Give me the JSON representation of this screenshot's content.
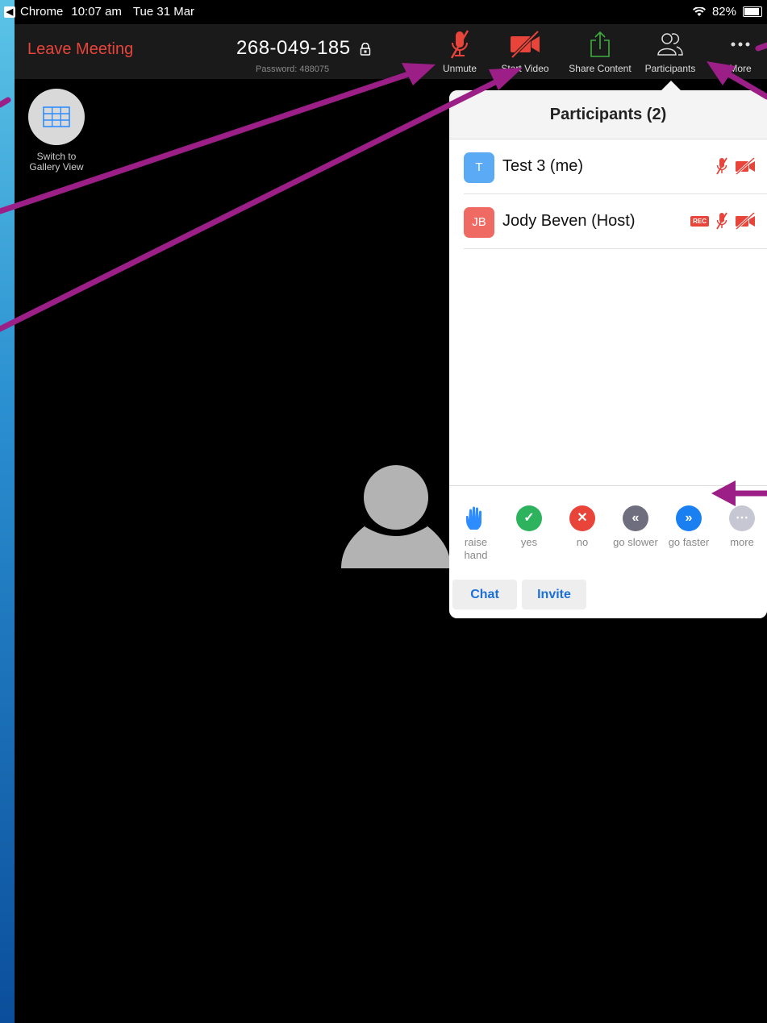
{
  "status_bar": {
    "back_app": "Chrome",
    "time": "10:07 am",
    "date": "Tue 31 Mar",
    "battery": "82%",
    "battery_level": 0.82
  },
  "toolbar": {
    "leave_label": "Leave Meeting",
    "meeting_id": "268-049-185",
    "password": "Password: 488075",
    "buttons": [
      {
        "label": "Unmute",
        "icon": "muted-mic-icon",
        "color": "#e8443a"
      },
      {
        "label": "Start Video",
        "icon": "video-off-icon",
        "color": "#e8443a"
      },
      {
        "label": "Share Content",
        "icon": "share-icon",
        "color": "#3fae3f"
      },
      {
        "label": "Participants",
        "icon": "participants-icon",
        "color": "#dddddd"
      },
      {
        "label": "More",
        "icon": "more-icon",
        "color": "#dddddd"
      }
    ]
  },
  "gallery": {
    "label_line1": "Switch to",
    "label_line2": "Gallery View"
  },
  "participants_panel": {
    "title": "Participants (2)",
    "participants": [
      {
        "initials": "T",
        "name": "Test 3 (me)",
        "avatar_color": "#5aaaf5",
        "recording": false
      },
      {
        "initials": "JB",
        "name": "Jody Beven (Host)",
        "avatar_color": "#f06a64",
        "recording": true,
        "rec_badge": "REC"
      }
    ],
    "reactions": [
      {
        "line1": "raise",
        "line2": "hand",
        "icon": "raise-hand-icon",
        "color": "#2d8cff"
      },
      {
        "line1": "yes",
        "line2": "",
        "icon": "checkmark-icon",
        "color": "#2db35d"
      },
      {
        "line1": "no",
        "line2": "",
        "icon": "x-icon",
        "color": "#e8443a"
      },
      {
        "line1": "go slower",
        "line2": "",
        "icon": "rewind-icon",
        "color": "#6e6e7e"
      },
      {
        "line1": "go faster",
        "line2": "",
        "icon": "fast-forward-icon",
        "color": "#1a7ff0"
      },
      {
        "line1": "more",
        "line2": "",
        "icon": "more-dots-icon",
        "color": "#c7c7d4"
      }
    ],
    "footer": {
      "chat_label": "Chat",
      "invite_label": "Invite"
    }
  },
  "colors": {
    "annotation_arrow": "#9b1f87",
    "background_gradient_top": "#5bc4e6",
    "background_gradient_bottom": "#0b4e9b"
  }
}
